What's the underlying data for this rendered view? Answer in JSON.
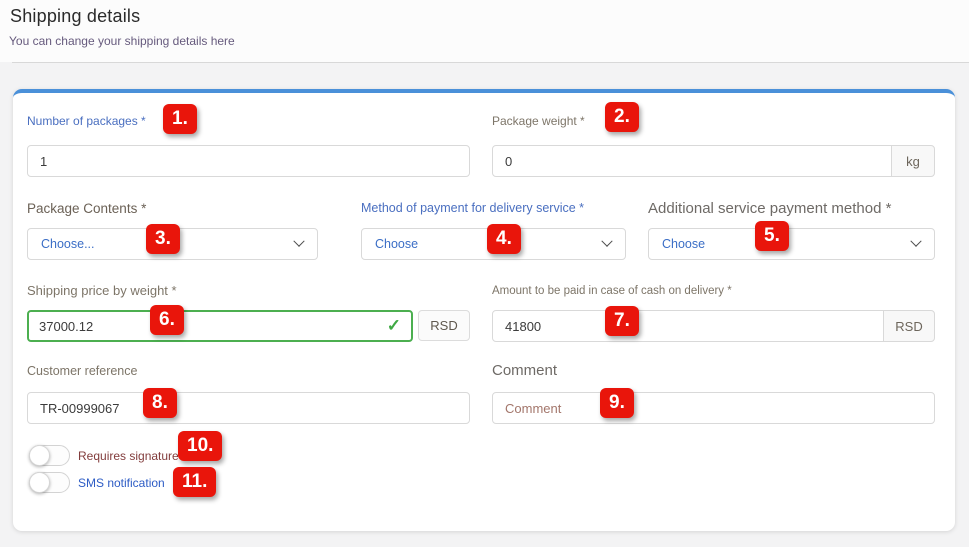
{
  "page": {
    "title": "Shipping details",
    "subtitle": "You can change your shipping details here"
  },
  "form": {
    "number_of_packages": {
      "label": "Number of packages *",
      "value": "1"
    },
    "package_weight": {
      "label": "Package weight *",
      "value": "0",
      "unit": "kg"
    },
    "package_contents": {
      "label": "Package Contents *",
      "value": "Choose..."
    },
    "delivery_payment_method": {
      "label": "Method of payment for delivery service *",
      "value": "Choose"
    },
    "additional_payment_method": {
      "label": "Additional service payment method *",
      "value": "Choose"
    },
    "shipping_price": {
      "label": "Shipping price by weight *",
      "value": "37000.12",
      "unit": "RSD"
    },
    "cod_amount": {
      "label": "Amount to be paid in case of cash on delivery *",
      "value": "41800",
      "unit": "RSD"
    },
    "customer_reference": {
      "label": "Customer reference",
      "value": "TR-00999067"
    },
    "comment": {
      "label": "Comment",
      "placeholder": "Comment",
      "value": ""
    },
    "requires_signature": {
      "label": "Requires signature",
      "checked": false
    },
    "sms_notification": {
      "label": "SMS notification",
      "checked": false
    }
  },
  "icons": {
    "valid_check": "✓",
    "chevron_down": "⌄"
  },
  "annotations": [
    "1.",
    "2.",
    "3.",
    "4.",
    "5.",
    "6.",
    "7.",
    "8.",
    "9.",
    "10.",
    "11."
  ],
  "colors": {
    "card_accent_top": "#4a90d9",
    "annotation_red": "#e9150b",
    "valid_green": "#4caf50",
    "label_blue": "#4a6fc0",
    "label_warm_gray": "#7d7568",
    "signature_label_maroon": "#823c3c",
    "sms_label_blue": "#2d5cc5"
  }
}
